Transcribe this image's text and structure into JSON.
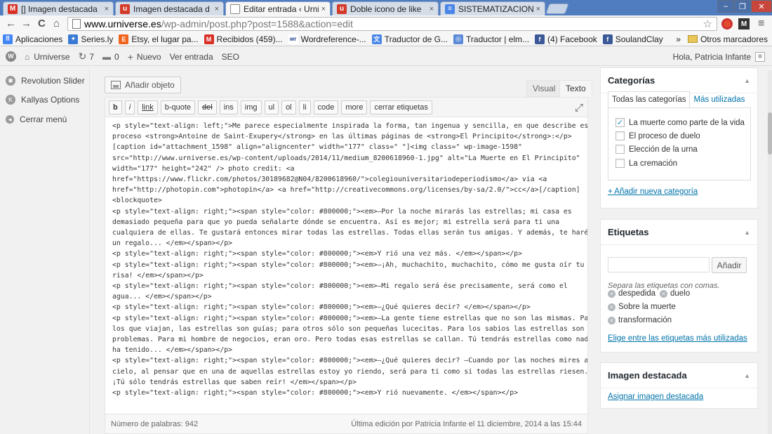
{
  "colors": {
    "tabstrip": "#4f7dc0",
    "gmail": "#d93025",
    "urniverse": "#d43b2a",
    "docs": "#4a86e8",
    "wp_link": "#0073aa",
    "checkbox": "#1e8cbe"
  },
  "browser": {
    "tabs": [
      {
        "label": "[] Imagen destacada",
        "close": "×",
        "icon": "gmail-icon",
        "fav": "M"
      },
      {
        "label": "Imagen destacada d",
        "close": "×",
        "icon": "urniverse-icon",
        "fav": "u"
      },
      {
        "label": "Editar entrada ‹ Urni",
        "close": "×",
        "icon": "page-icon",
        "fav": ""
      },
      {
        "label": "Doble icono de like",
        "close": "×",
        "icon": "urniverse-icon",
        "fav": "u"
      },
      {
        "label": "SISTEMATIZACIONE",
        "close": "×",
        "icon": "docs-icon",
        "fav": "≡"
      }
    ],
    "address": {
      "host": "www.urniverse.es",
      "path": "/wp-admin/post.php?post=1588&action=edit"
    },
    "nav": {
      "back": "←",
      "forward": "→",
      "reload": "C",
      "home": "⌂",
      "star": "☆",
      "menu": "≡"
    },
    "bookmarks": [
      {
        "label": "Aplicaciones",
        "icon": "apps-icon"
      },
      {
        "label": "Series.ly",
        "icon": "seriesly-icon"
      },
      {
        "label": "Etsy, el lugar pa...",
        "icon": "etsy-icon"
      },
      {
        "label": "Recibidos (459)...",
        "icon": "gmail-icon"
      },
      {
        "label": "Wordreference-...",
        "icon": "wordreference-icon"
      },
      {
        "label": "Traductor de G...",
        "icon": "translate-icon"
      },
      {
        "label": "Traductor | elm...",
        "icon": "translate-icon"
      },
      {
        "label": "(4) Facebook",
        "icon": "facebook-icon"
      },
      {
        "label": "SoulandClay",
        "icon": "facebook-icon"
      }
    ],
    "bookmarks_more": "»",
    "other_bookmarks": "Otros marcadores"
  },
  "adminbar": {
    "site": "Urniverse",
    "updates": "7",
    "comments": "0",
    "new": "Nuevo",
    "view": "Ver entrada",
    "seo": "SEO",
    "greeting": "Hola, Patricia Infante"
  },
  "menu": [
    {
      "label": "Revolution Slider",
      "icon": "gear-icon"
    },
    {
      "label": "Kallyas Options",
      "icon": "k-icon"
    },
    {
      "label": "Cerrar menú",
      "icon": "collapse-icon"
    }
  ],
  "editor": {
    "add_media": "Añadir objeto",
    "tabs": {
      "visual": "Visual",
      "text": "Texto"
    },
    "quicktags": [
      "b",
      "i",
      "link",
      "b-quote",
      "del",
      "ins",
      "img",
      "ul",
      "ol",
      "li",
      "code",
      "more",
      "cerrar etiquetas"
    ],
    "lines": [
      "<p style=\"text-align: left;\">Me parece especialmente inspirada la forma, tan ingenua y sencilla, en que describe este",
      "proceso <strong>Antoine de Saint-Exupery</strong> en las últimas páginas de <strong>El Principito</strong>:</p>",
      "",
      "",
      "[caption id=\"attachment_1598\" align=\"aligncenter\" width=\"177\" class=\" \"]<img class=\" wp-image-1598\"",
      "src=\"http://www.urniverse.es/wp-content/uploads/2014/11/medium_8200618960-1.jpg\" alt=\"La Muerte en El Principito\"",
      "width=\"177\" height=\"242\" /> photo credit: <a",
      "href=\"https://www.flickr.com/photos/30189682@N04/8200618960/\">colegiouniversitariodeperiodismo</a> via <a",
      "href=\"http://photopin.com\">photopin</a> <a href=\"http://creativecommons.org/licenses/by-sa/2.0/\">cc</a>[/caption]",
      "<blockquote>",
      "<p style=\"text-align: right;\"><span style=\"color: #800000;\"><em>—Por la noche mirarás las estrellas; mi casa es",
      "demasiado pequeña para que yo pueda señalarte dónde se encuentra. Así es mejor; mi estrella será para ti una",
      "cualquiera de ellas. Te gustará entonces mirar todas las estrellas. Todas ellas serán tus amigas. Y además, te haré",
      "un regalo... </em></span></p>",
      "<p style=\"text-align: right;\"><span style=\"color: #800000;\"><em>Y rió una vez más. </em></span></p>",
      "<p style=\"text-align: right;\"><span style=\"color: #800000;\"><em>—¡Ah, muchachito, muchachito, cómo me gusta oír tu",
      "risa! </em></span></p>",
      "<p style=\"text-align: right;\"><span style=\"color: #800000;\"><em>—Mi regalo será ése precisamente, será como el",
      "agua... </em></span></p>",
      "<p style=\"text-align: right;\"><span style=\"color: #800000;\"><em>—¿Qué quieres decir? </em></span></p>",
      "<p style=\"text-align: right;\"><span style=\"color: #800000;\"><em>—La gente tiene estrellas que no son las mismas. Para",
      "los que viajan, las estrellas son guías; para otros sólo son pequeñas lucecitas. Para los sabios las estrellas son",
      "problemas. Para mi hombre de negocios, eran oro. Pero todas esas estrellas se callan. Tú tendrás estrellas como nadie",
      "ha tenido... </em></span></p>",
      "<p style=\"text-align: right;\"><span style=\"color: #800000;\"><em>—¿Qué quieres decir? —Cuando por las noches mires al",
      "cielo, al pensar que en una de aquellas estrellas estoy yo riendo, será para ti como si todas las estrellas riesen.",
      "¡Tú sólo tendrás estrellas que saben reír! </em></span></p>",
      "<p style=\"text-align: right;\"><span style=\"color: #800000;\"><em>Y rió nuevamente. </em></span></p>"
    ],
    "word_count": "Número de palabras: 942",
    "last_edit": "Última edición por Patricia Infante el 11 diciembre, 2014 a las 15:44"
  },
  "categories": {
    "title": "Categorías",
    "tab_all": "Todas las categorías",
    "tab_popular": "Más utilizadas",
    "items": [
      {
        "label": "La muerte como parte de la vida",
        "checked": true
      },
      {
        "label": "El proceso de duelo",
        "checked": false
      },
      {
        "label": "Elección de la urna",
        "checked": false
      },
      {
        "label": "La cremación",
        "checked": false
      }
    ],
    "add_new": "+ Añadir nueva categoría"
  },
  "tags": {
    "title": "Etiquetas",
    "add_button": "Añadir",
    "hint": "Separa las etiquetas con comas.",
    "items": [
      "despedida",
      "duelo",
      "Sobre la muerte",
      "transformación"
    ],
    "choose": "Elige entre las etiquetas más utilizadas"
  },
  "featured": {
    "title": "Imagen destacada",
    "assign": "Asignar imagen destacada"
  }
}
